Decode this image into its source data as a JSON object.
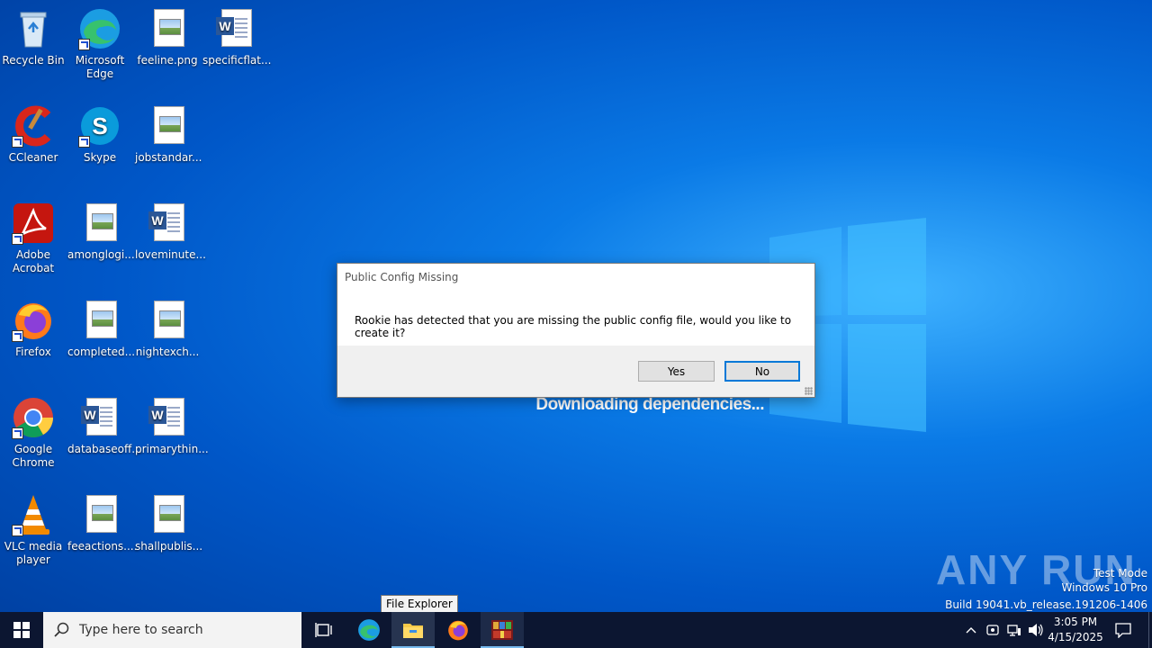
{
  "desktop": {
    "icons": [
      {
        "label": "Recycle Bin",
        "icon": "recycle-bin-icon"
      },
      {
        "label": "Microsoft Edge",
        "icon": "edge-icon"
      },
      {
        "label": "feeline.png",
        "icon": "image-file-icon"
      },
      {
        "label": "specificflat...",
        "icon": "word-file-icon"
      },
      {
        "label": "CCleaner",
        "icon": "ccleaner-icon"
      },
      {
        "label": "Skype",
        "icon": "skype-icon"
      },
      {
        "label": "jobstandar...",
        "icon": "image-file-icon"
      },
      {
        "label": "Adobe Acrobat",
        "icon": "acrobat-icon"
      },
      {
        "label": "amonglogi...",
        "icon": "image-file-icon"
      },
      {
        "label": "loveminute...",
        "icon": "word-file-icon"
      },
      {
        "label": "Firefox",
        "icon": "firefox-icon"
      },
      {
        "label": "completed...",
        "icon": "image-file-icon"
      },
      {
        "label": "nightexch...",
        "icon": "image-file-icon"
      },
      {
        "label": "Google Chrome",
        "icon": "chrome-icon"
      },
      {
        "label": "databaseoff...",
        "icon": "word-file-icon"
      },
      {
        "label": "primarythin...",
        "icon": "word-file-icon"
      },
      {
        "label": "VLC media player",
        "icon": "vlc-icon"
      },
      {
        "label": "feeactions....",
        "icon": "image-file-icon"
      },
      {
        "label": "shallpublis...",
        "icon": "image-file-icon"
      }
    ]
  },
  "splash": {
    "status_text": "Downloading dependencies..."
  },
  "dialog": {
    "title": "Public Config Missing",
    "message": "Rookie has detected that you are missing the public config file, would you like to create it?",
    "yes_label": "Yes",
    "no_label": "No"
  },
  "tooltip": {
    "text": "File Explorer"
  },
  "watermark": {
    "logo_text": "ANY RUN",
    "test_mode": "Test Mode",
    "edition": "Windows 10 Pro",
    "build": "Build 19041.vb_release.191206-1406"
  },
  "taskbar": {
    "search_placeholder": "Type here to search",
    "time": "3:05 PM",
    "date": "4/15/2025"
  },
  "colors": {
    "taskbar": "#0c1631",
    "accent": "#0078d7",
    "desktop": "#0a7ae6"
  }
}
